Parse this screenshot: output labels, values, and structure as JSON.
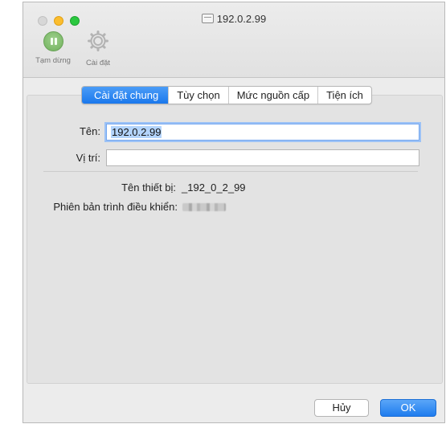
{
  "window": {
    "title": "192.0.2.99"
  },
  "toolbar": {
    "pause_label": "Tạm dừng",
    "settings_label": "Cài đặt"
  },
  "tabs": [
    {
      "label": "Cài đặt chung",
      "active": true
    },
    {
      "label": "Tùy chọn",
      "active": false
    },
    {
      "label": "Mức nguồn cấp",
      "active": false
    },
    {
      "label": "Tiện ích",
      "active": false
    }
  ],
  "form": {
    "name_label": "Tên:",
    "name_value": "192.0.2.99",
    "location_label": "Vị trí:",
    "location_value": "",
    "device_name_label": "Tên thiết bị:",
    "device_name_value": "_192_0_2_99",
    "driver_version_label": "Phiên bản trình điều khiển:"
  },
  "buttons": {
    "cancel": "Hủy",
    "ok": "OK"
  },
  "colors": {
    "accent": "#1a78ec",
    "close": "#d7d7d7",
    "minimize": "#fbbd2e",
    "maximize": "#2ac83f",
    "pause": "#6fb15a"
  },
  "icons": {
    "pause": "pause-icon",
    "settings": "gear-icon",
    "title": "document-icon"
  }
}
